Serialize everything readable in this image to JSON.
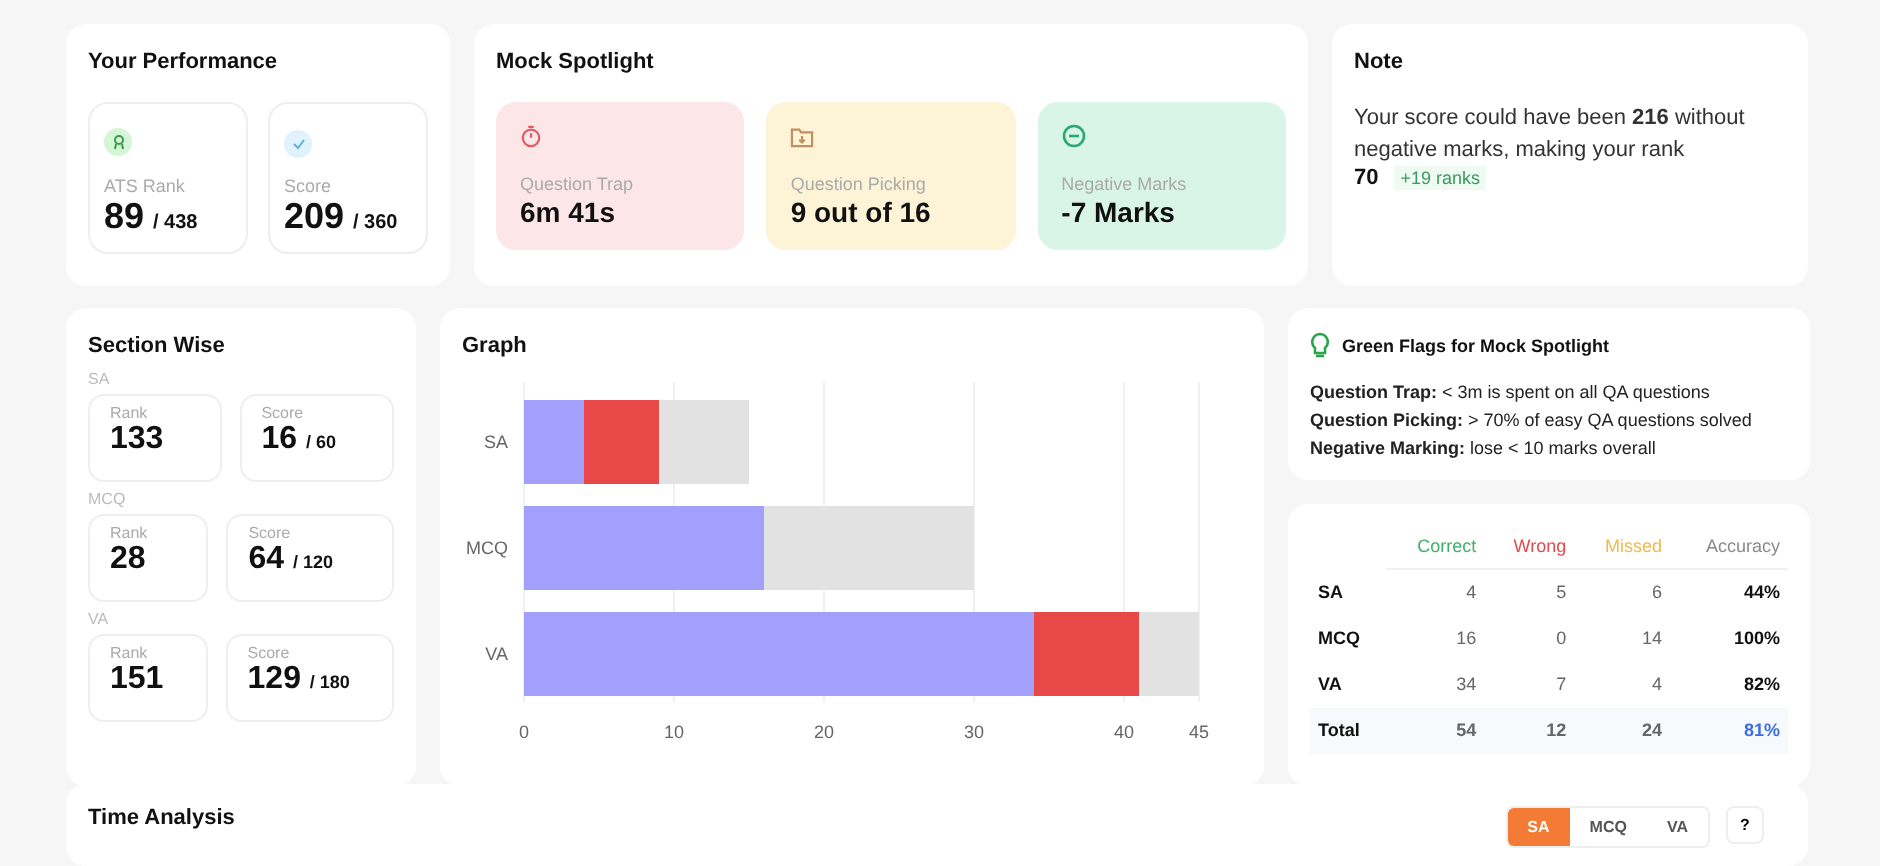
{
  "performance": {
    "title": "Your Performance",
    "stats": [
      {
        "kind": "rank",
        "label": "ATS Rank",
        "value": "89",
        "total": "/ 438"
      },
      {
        "kind": "score",
        "label": "Score",
        "value": "209",
        "total": "/ 360"
      }
    ]
  },
  "spotlight": {
    "title": "Mock Spotlight",
    "cards": [
      {
        "kind": "timer",
        "label": "Question Trap",
        "value": "6m 41s",
        "color": "#fde6e8"
      },
      {
        "kind": "folder",
        "label": "Question Picking",
        "value": "9 out of 16",
        "color": "#fdf3d6"
      },
      {
        "kind": "minus",
        "label": "Negative Marks",
        "value": "-7 Marks",
        "color": "#d8f5e8"
      }
    ]
  },
  "note": {
    "title": "Note",
    "text": "Your score could have been **216** without negative marks, making your rank",
    "rank": "70",
    "rank_change": "+19 ranks"
  },
  "section_wise": {
    "title": "Section Wise",
    "sections": [
      {
        "name": "SA",
        "rank_label": "Rank",
        "rank": "133",
        "score_label": "Score",
        "score": "16",
        "score_total": "/ 60"
      },
      {
        "name": "MCQ",
        "rank_label": "Rank",
        "rank": "28",
        "score_label": "Score",
        "score": "64",
        "score_total": "/ 120"
      },
      {
        "name": "VA",
        "rank_label": "Rank",
        "rank": "151",
        "score_label": "Score",
        "score": "129",
        "score_total": "/ 180"
      }
    ]
  },
  "graph": {
    "title": "Graph",
    "chart_data": {
      "type": "bar",
      "orientation": "horizontal",
      "stacked": true,
      "grid": true,
      "categories": [
        "SA",
        "MCQ",
        "VA"
      ],
      "series": [
        {
          "color": "#a3a0fb",
          "values": [
            4,
            16,
            34
          ]
        },
        {
          "color": "#e84848",
          "values": [
            5,
            0,
            7
          ]
        },
        {
          "color": "#e2e2e2",
          "values": [
            6,
            14,
            4
          ]
        }
      ],
      "xlim": [
        0,
        45
      ],
      "xticks": [
        0,
        10,
        20,
        30,
        40,
        45
      ]
    }
  },
  "green_flags": {
    "title": "Green Flags for Mock Spotlight",
    "items": [
      "**Question Trap:** < 3m is spent on all QA questions",
      "**Question Picking:** > 70% of easy QA questions solved",
      "**Negative Marking:** lose < 10 marks overall"
    ]
  },
  "summary_table": {
    "columns": [
      {},
      {
        "label": "Correct",
        "color": "#3fae6b"
      },
      {
        "label": "Wrong",
        "color": "#e5484d"
      },
      {
        "label": "Missed",
        "color": "#f2b94a"
      },
      {
        "label": "Accuracy",
        "color": "#8a8a8a"
      }
    ],
    "rows": [
      {
        "kind": "section",
        "cells": [
          "SA",
          "4",
          "5",
          "6",
          "44%"
        ]
      },
      {
        "kind": "section",
        "cells": [
          "MCQ",
          "16",
          "0",
          "14",
          "100%"
        ]
      },
      {
        "kind": "section",
        "cells": [
          "VA",
          "34",
          "7",
          "4",
          "82%"
        ]
      },
      {
        "kind": "total",
        "cells": [
          "Total",
          "54",
          "12",
          "24",
          "81%"
        ]
      }
    ]
  },
  "time_analysis": {
    "title": "Time Analysis",
    "tabs": [
      {
        "label": "SA",
        "selected": true
      },
      {
        "label": "MCQ",
        "selected": false
      },
      {
        "label": "VA",
        "selected": false
      }
    ],
    "help": "?"
  }
}
